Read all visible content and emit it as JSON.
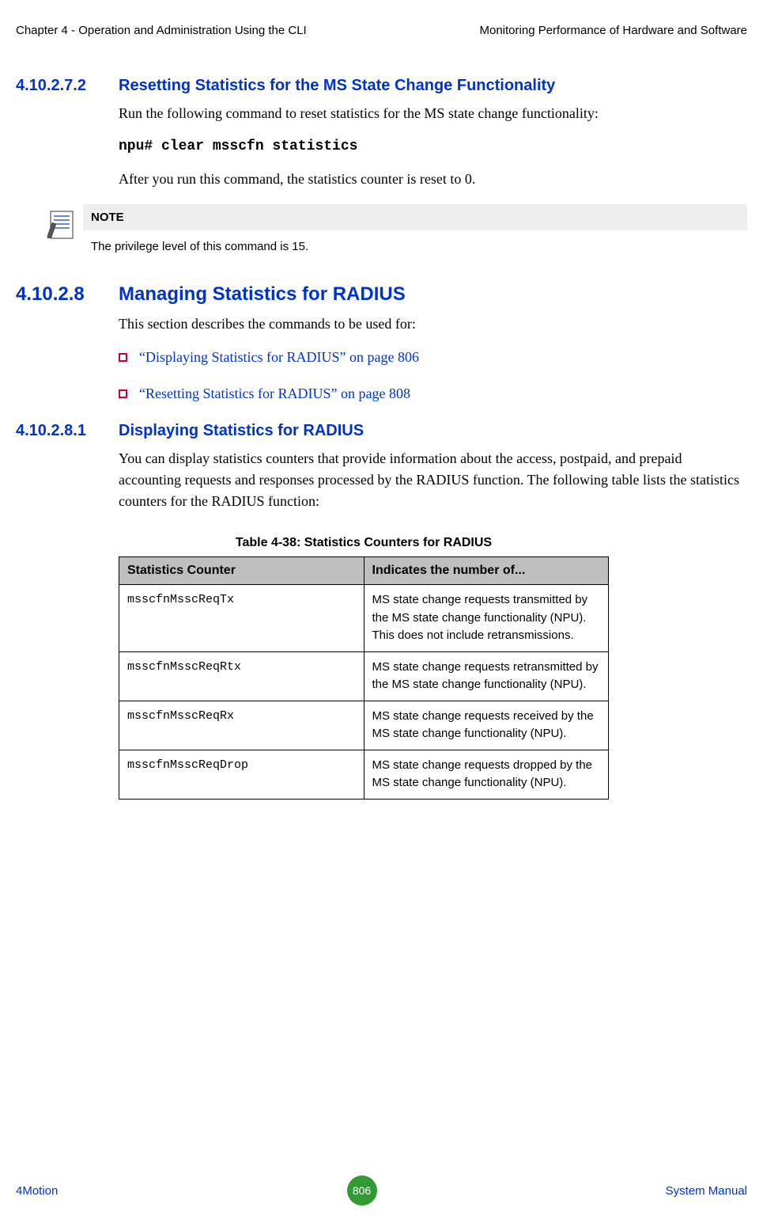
{
  "header": {
    "left": "Chapter 4 - Operation and Administration Using the CLI",
    "right": "Monitoring Performance of Hardware and Software"
  },
  "sections": {
    "s1": {
      "num": "4.10.2.7.2",
      "title": "Resetting Statistics for the MS State Change Functionality",
      "body1": "Run the following command to reset statistics for the MS state change functionality:",
      "code": "npu# clear msscfn statistics",
      "body2": "After you run this command, the statistics counter is reset to 0."
    },
    "note": {
      "label": "NOTE",
      "text": "The privilege level of this command is 15."
    },
    "s2": {
      "num": "4.10.2.8",
      "title": "Managing Statistics for RADIUS",
      "body": "This section describes the commands to be used for:"
    },
    "bullets": [
      "“Displaying Statistics for RADIUS” on page 806",
      "“Resetting Statistics for RADIUS” on page 808"
    ],
    "s3": {
      "num": "4.10.2.8.1",
      "title": "Displaying Statistics for RADIUS",
      "body": "You can display statistics counters that provide information about the access, postpaid, and prepaid accounting requests and responses processed by the RADIUS function. The following table lists the statistics counters for the RADIUS function:"
    }
  },
  "table": {
    "caption": "Table 4-38: Statistics Counters for RADIUS",
    "headers": [
      "Statistics Counter",
      "Indicates the number of..."
    ],
    "rows": [
      [
        "msscfnMsscReqTx",
        "MS state change requests transmitted by the MS state change functionality (NPU). This does not include retransmissions."
      ],
      [
        "msscfnMsscReqRtx",
        "MS state change requests retransmitted by the MS state change functionality (NPU)."
      ],
      [
        "msscfnMsscReqRx",
        "MS state change requests received by the MS state change functionality (NPU)."
      ],
      [
        "msscfnMsscReqDrop",
        "MS state change requests dropped by the MS state change functionality (NPU)."
      ]
    ]
  },
  "footer": {
    "left": "4Motion",
    "center": "806",
    "right": "System Manual"
  }
}
